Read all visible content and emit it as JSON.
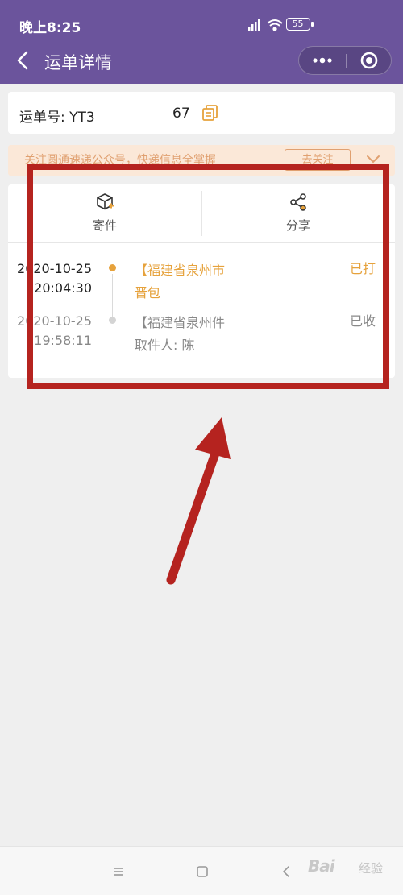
{
  "status_bar": {
    "time": "晚上8:25",
    "battery": "55"
  },
  "header": {
    "title": "运单详情"
  },
  "waybill": {
    "label": "运单号: YT3",
    "number_tail": "67"
  },
  "notice": {
    "text": "关注圆通速递公众号，快递信息全掌握",
    "follow_button": "去关注"
  },
  "actions": [
    {
      "label": "寄件",
      "icon": "package-add-icon"
    },
    {
      "label": "分享",
      "icon": "share-icon"
    }
  ],
  "timeline": [
    {
      "date": "2020-10-25",
      "time": "20:04:30",
      "description": "【福建省泉州市晋包",
      "status": "已打",
      "active": true
    },
    {
      "date": "2020-10-25",
      "time": "19:58:11",
      "description": "【福建省泉州件 取件人: 陈",
      "status": "已收",
      "active": false
    }
  ],
  "colors": {
    "header_bg": "#6b549c",
    "accent_orange": "#e6a23c",
    "annotation_red": "#b5231f",
    "inactive_text": "#888888"
  },
  "bottom_nav": {
    "watermark": "Bai",
    "watermark_sub": "经验"
  }
}
